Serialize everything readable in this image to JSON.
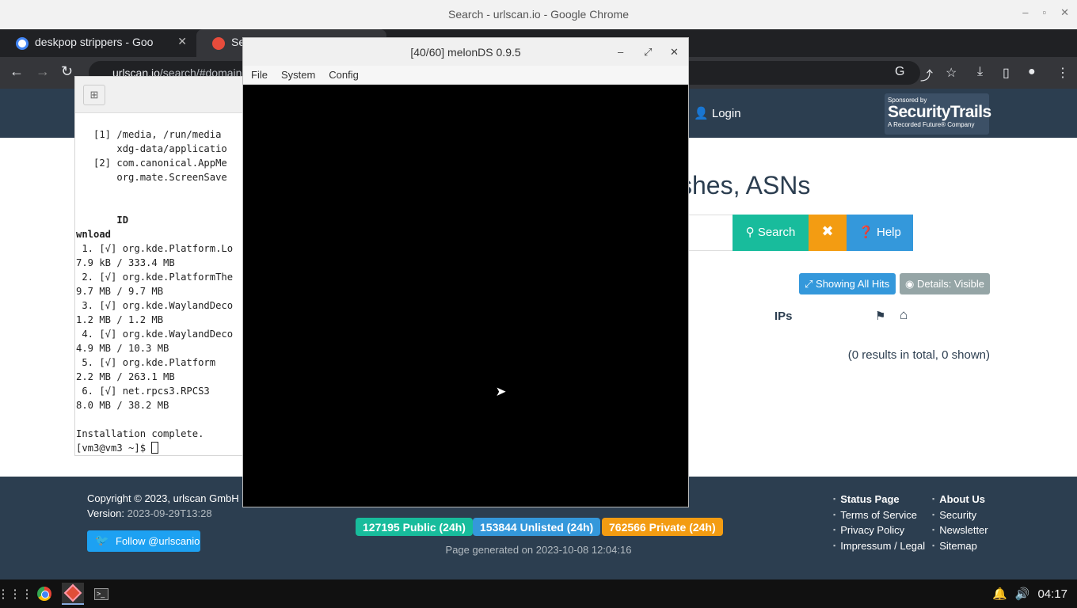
{
  "chrome": {
    "window_title": "Search - urlscan.io - Google Chrome",
    "tabs": [
      {
        "label": "deskpop strippers - Goo"
      },
      {
        "label": "Sea"
      }
    ],
    "url_host": "urlscan.io",
    "url_path": "/search/#domain",
    "minimize": "–",
    "maximize": "▫",
    "close": "✕"
  },
  "urlscan": {
    "login": "Login",
    "sponsor": {
      "small": "Sponsored by",
      "big": "SecurityTrails",
      "tiny": "A Recorded Future® Company"
    },
    "headline": "shes, ASNs",
    "buttons": {
      "search": "Search",
      "clear": "✖",
      "help": "Help"
    },
    "showing_all_hits": "Showing All Hits",
    "details_visible": "Details: Visible",
    "col_ips": "IPs",
    "results_text": "(0 results in total, 0 shown)",
    "footer": {
      "copyright": "Copyright © 2023, urlscan GmbH",
      "version_label": "Version:",
      "version_value": "2023-09-29T13:28",
      "follow": "Follow @urlscanio",
      "stats": {
        "public": "127195 Public (24h)",
        "unlisted": "153844 Unlisted (24h)",
        "private": "762566 Private (24h)"
      },
      "generated": "Page generated on 2023-10-08 12:04:16",
      "col1": [
        "Status Page",
        "Terms of Service",
        "Privacy Policy",
        "Impressum / Legal"
      ],
      "col2": [
        "About Us",
        "Security",
        "Newsletter",
        "Sitemap"
      ]
    }
  },
  "terminal": {
    "lines": [
      "   [1] /media, /run/media",
      "       xdg-data/applicatio",
      "   [2] com.canonical.AppMe",
      "       org.mate.ScreenSave",
      "",
      "",
      "       ID",
      "wnload",
      " 1. [√] org.kde.Platform.Lo",
      "7.9 kB / 333.4 MB",
      " 2. [√] org.kde.PlatformThe",
      "9.7 MB / 9.7 MB",
      " 3. [√] org.kde.WaylandDeco",
      "1.2 MB / 1.2 MB",
      " 4. [√] org.kde.WaylandDeco",
      "4.9 MB / 10.3 MB",
      " 5. [√] org.kde.Platform",
      "2.2 MB / 263.1 MB",
      " 6. [√] net.rpcs3.RPCS3",
      "8.0 MB / 38.2 MB",
      "",
      "Installation complete."
    ],
    "prompt": "[vm3@vm3 ~]$ "
  },
  "melonds": {
    "title": "[40/60] melonDS 0.9.5",
    "menu": [
      "File",
      "System",
      "Config"
    ]
  },
  "taskbar": {
    "clock": "04:17"
  }
}
